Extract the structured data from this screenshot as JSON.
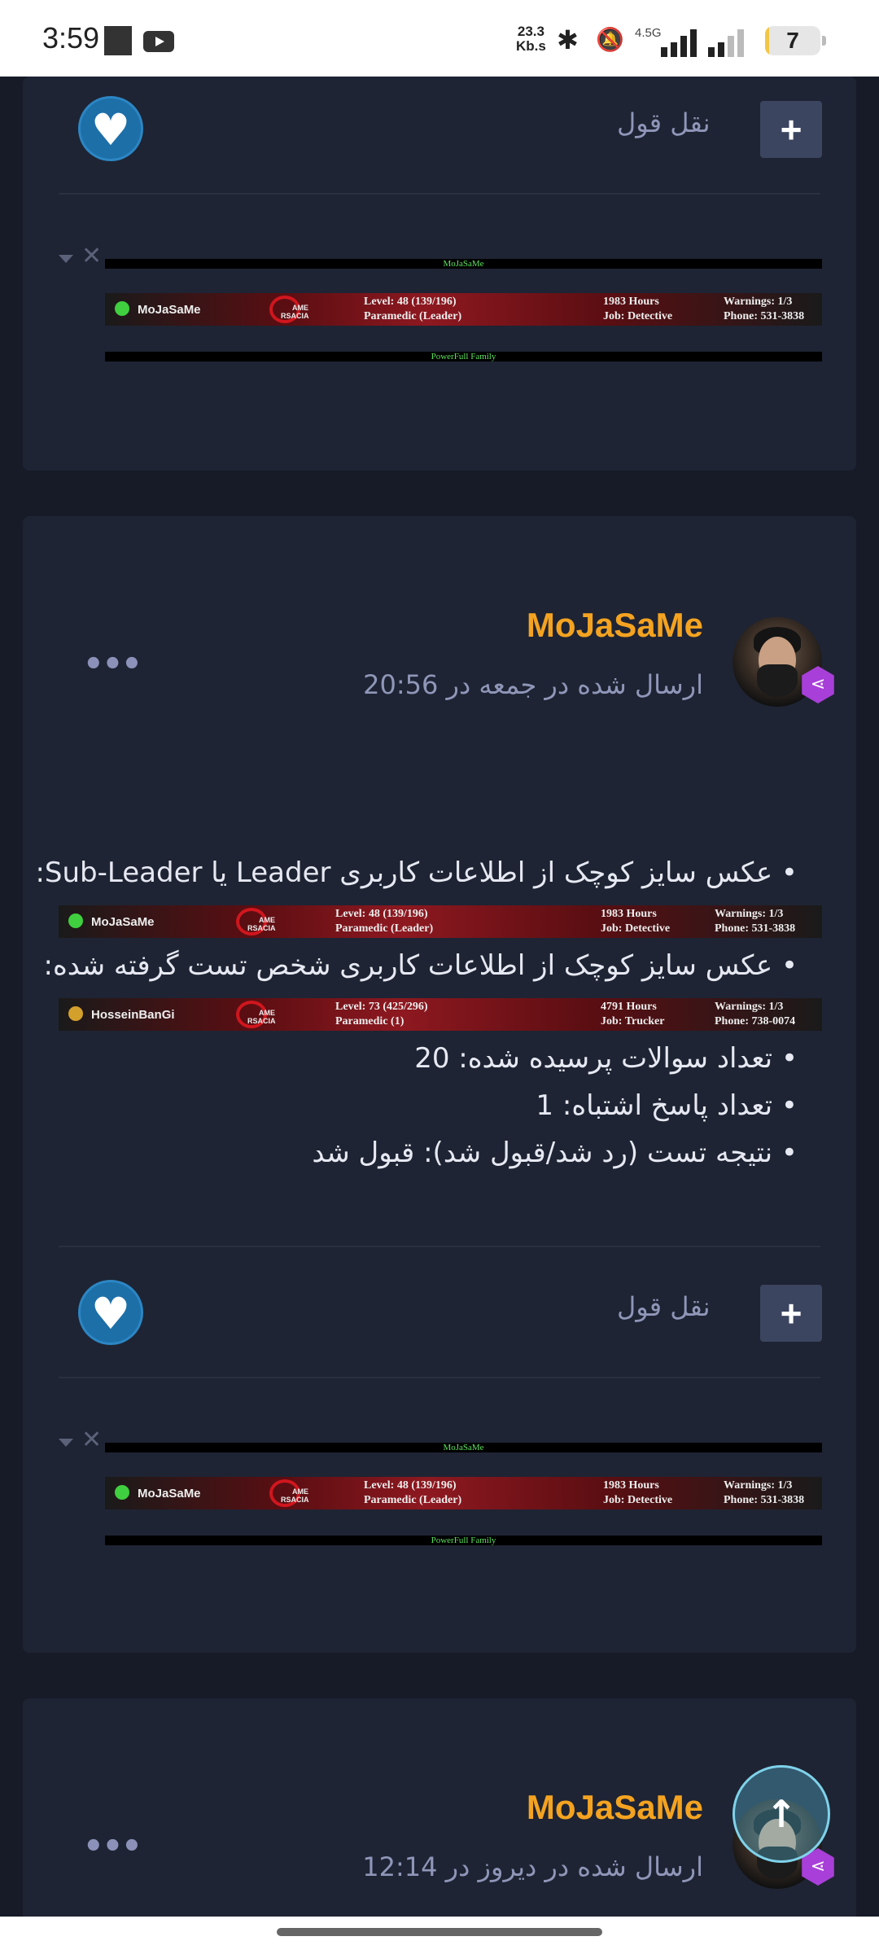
{
  "status_bar": {
    "time": "3:59",
    "net_speed_value": "23.3",
    "net_speed_unit": "Kb.s",
    "network_type": "4.5G",
    "battery": "7",
    "battery_level": 0.07
  },
  "cards": {
    "top": {
      "quote_label": "نقل قول",
      "plus_label": "+",
      "signature_top": "MoJaSaMe",
      "signature_bottom": "PowerFull Family"
    },
    "post1": {
      "author": "MoJaSaMe",
      "posted": "ارسال شده در جمعه در 20:56",
      "lines": [
        "• عکس سایز کوچک از اطلاعات کاربری Leader یا Sub-Leader:",
        "• عکس سایز کوچک از اطلاعات کاربری شخص تست گرفته شده:",
        "• تعداد سوالات پرسیده شده: 20",
        "• تعداد پاسخ اشتباه: 1",
        "• نتیجه تست (رد شد/قبول شد): قبول شد"
      ],
      "quote_label": "نقل قول",
      "plus_label": "+",
      "signature_top": "MoJaSaMe",
      "signature_bottom": "PowerFull Family"
    },
    "post2": {
      "author": "MoJaSaMe",
      "posted": "ارسال شده در دیروز در 12:14"
    }
  },
  "banners": {
    "leader": {
      "name": "MoJaSaMe",
      "logo_top": "AME",
      "logo_bottom": "RSACIA",
      "level": "Level: 48 (139/196)",
      "rank": "Paramedic (Leader)",
      "hours": "1983 Hours",
      "job": "Job: Detective",
      "warnings": "Warnings: 1/3",
      "phone": "Phone: 531-3838",
      "dot_color": "#3fcf3f"
    },
    "tested": {
      "name": "HosseinBanGi",
      "logo_top": "AME",
      "logo_bottom": "RSACIA",
      "level": "Level: 73 (425/296)",
      "rank": "Paramedic (1)",
      "hours": "4791 Hours",
      "job": "Job: Trucker",
      "warnings": "Warnings: 1/3",
      "phone": "Phone: 738-0074",
      "dot_color": "#d4a02c"
    }
  },
  "icons": {
    "like": "heart-icon",
    "plus": "plus-icon",
    "share": "share-icon",
    "more": "more-dots-icon",
    "scroll_top": "arrow-up-icon"
  },
  "colors": {
    "background": "#161b27",
    "card": "#1e2433",
    "author": "#f4a320",
    "like": "#1d6fa8",
    "share_badge": "#a83fd8"
  }
}
